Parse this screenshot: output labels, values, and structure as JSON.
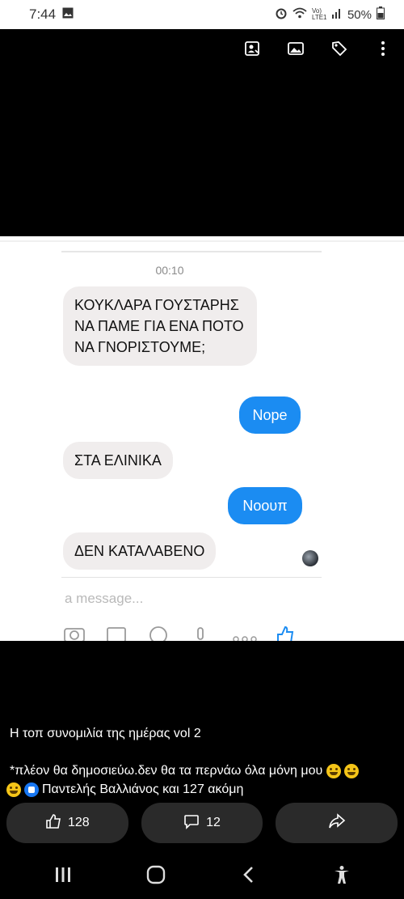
{
  "status_bar": {
    "time": "7:44",
    "battery": "50%"
  },
  "viewer": {
    "toolbar_icons": [
      "tag-person-icon",
      "image-icon",
      "tag-icon",
      "more-vertical-icon"
    ]
  },
  "chat": {
    "time": "00:10",
    "messages": [
      {
        "side": "in",
        "text": "ΚΟΥΚΛΑΡΑ ΓΟΥΣΤΑΡΗΣ ΝΑ ΠΑΜΕ ΓΙΑ ΕΝΑ ΠΟΤΟ ΝΑ ΓΝΟΡΙΣΤΟΥΜΕ;"
      },
      {
        "side": "out",
        "text": "Nope"
      },
      {
        "side": "in",
        "text": "ΣΤΑ ΕΛΙΝΙΚΑ"
      },
      {
        "side": "out",
        "text": "Νοουπ"
      },
      {
        "side": "in",
        "text": "ΔΕΝ ΚΑΤΑΛΑΒΕΝΟ"
      }
    ],
    "compose_placeholder": "a message..."
  },
  "post": {
    "title": "Η τοπ συνομιλία της ημέρας vol 2",
    "description": "*πλέον θα δημοσιεύω.δεν θα τα περνάω όλα μόνη μου",
    "reactions_text": "Παντελής Βαλλιάνος και 127 ακόμη",
    "likes": "128",
    "comments": "12"
  },
  "colors": {
    "accent_blue": "#1b8cf2",
    "incoming_bubble": "#f0eded",
    "action_bg": "#2a2a2a"
  }
}
